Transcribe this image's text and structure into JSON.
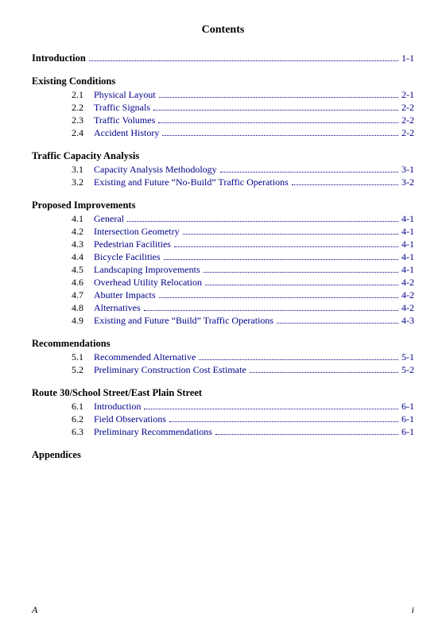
{
  "page": {
    "title": "Contents"
  },
  "toc": {
    "intro": {
      "label": "Introduction",
      "page": "1-1"
    },
    "sections": [
      {
        "id": "existing-conditions",
        "label": "Existing Conditions",
        "page": null,
        "items": [
          {
            "number": "2.1",
            "label": "Physical Layout",
            "page": "2-1"
          },
          {
            "number": "2.2",
            "label": "Traffic Signals",
            "page": "2-2"
          },
          {
            "number": "2.3",
            "label": "Traffic Volumes",
            "page": "2-2"
          },
          {
            "number": "2.4",
            "label": "Accident History",
            "page": "2-2"
          }
        ]
      },
      {
        "id": "traffic-capacity",
        "label": "Traffic Capacity Analysis",
        "page": null,
        "items": [
          {
            "number": "3.1",
            "label": "Capacity Analysis Methodology",
            "page": "3-1"
          },
          {
            "number": "3.2",
            "label": "Existing and Future “No-Build” Traffic Operations",
            "page": "3-2"
          }
        ]
      },
      {
        "id": "proposed-improvements",
        "label": "Proposed Improvements",
        "page": null,
        "items": [
          {
            "number": "4.1",
            "label": "General",
            "page": "4-1"
          },
          {
            "number": "4.2",
            "label": "Intersection Geometry",
            "page": "4-1"
          },
          {
            "number": "4.3",
            "label": "Pedestrian Facilities",
            "page": "4-1"
          },
          {
            "number": "4.4",
            "label": "Bicycle Facilities",
            "page": "4-1"
          },
          {
            "number": "4.5",
            "label": "Landscaping Improvements",
            "page": "4-1"
          },
          {
            "number": "4.6",
            "label": "Overhead Utility Relocation",
            "page": "4-2"
          },
          {
            "number": "4.7",
            "label": "Abutter Impacts",
            "page": "4-2"
          },
          {
            "number": "4.8",
            "label": "Alternatives",
            "page": "4-2"
          },
          {
            "number": "4.9",
            "label": "Existing and Future “Build” Traffic Operations",
            "page": "4-3"
          }
        ]
      },
      {
        "id": "recommendations",
        "label": "Recommendations",
        "page": null,
        "items": [
          {
            "number": "5.1",
            "label": "Recommended Alternative",
            "page": "5-1"
          },
          {
            "number": "5.2",
            "label": "Preliminary Construction Cost Estimate",
            "page": "5-2"
          }
        ]
      },
      {
        "id": "route30",
        "label": "Route 30/School Street/East Plain Street",
        "page": null,
        "items": [
          {
            "number": "6.1",
            "label": "Introduction",
            "page": "6-1"
          },
          {
            "number": "6.2",
            "label": "Field Observations",
            "page": "6-1"
          },
          {
            "number": "6.3",
            "label": "Preliminary Recommendations",
            "page": "6-1"
          }
        ]
      }
    ],
    "appendices": {
      "label": "Appendices"
    }
  },
  "footer": {
    "left": "A",
    "right": "i"
  }
}
